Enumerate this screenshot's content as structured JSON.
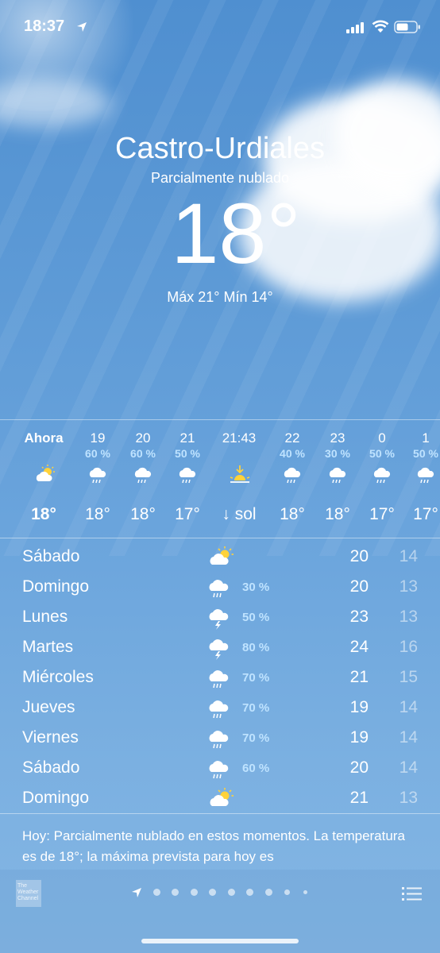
{
  "status": {
    "time": "18:37",
    "icons": [
      "location-arrow-icon",
      "signal-icon",
      "wifi-icon",
      "battery-icon"
    ]
  },
  "weather": {
    "city": "Castro-Urdiales",
    "condition": "Parcialmente nublado",
    "temperature": "18°",
    "hilo": "Máx 21° Mín 14°"
  },
  "hourly": [
    {
      "hour": "Ahora",
      "precip": "",
      "icon": "partly-cloudy-icon",
      "temp": "18°"
    },
    {
      "hour": "19",
      "precip": "60 %",
      "icon": "rain-icon",
      "temp": "18°"
    },
    {
      "hour": "20",
      "precip": "60 %",
      "icon": "rain-icon",
      "temp": "18°"
    },
    {
      "hour": "21",
      "precip": "50 %",
      "icon": "rain-icon",
      "temp": "17°"
    },
    {
      "hour": "21:43",
      "precip": "",
      "icon": "sunset-icon",
      "temp": "↓ sol"
    },
    {
      "hour": "22",
      "precip": "40 %",
      "icon": "rain-icon",
      "temp": "18°"
    },
    {
      "hour": "23",
      "precip": "30 %",
      "icon": "rain-icon",
      "temp": "18°"
    },
    {
      "hour": "0",
      "precip": "50 %",
      "icon": "rain-icon",
      "temp": "17°"
    },
    {
      "hour": "1",
      "precip": "50 %",
      "icon": "rain-icon",
      "temp": "17°"
    }
  ],
  "daily": [
    {
      "day": "Sábado",
      "icon": "partly-cloudy-icon",
      "precip": "",
      "high": "20",
      "low": "14"
    },
    {
      "day": "Domingo",
      "icon": "rain-icon",
      "precip": "30 %",
      "high": "20",
      "low": "13"
    },
    {
      "day": "Lunes",
      "icon": "thunderstorm-icon",
      "precip": "50 %",
      "high": "23",
      "low": "13"
    },
    {
      "day": "Martes",
      "icon": "thunderstorm-icon",
      "precip": "80 %",
      "high": "24",
      "low": "16"
    },
    {
      "day": "Miércoles",
      "icon": "rain-icon",
      "precip": "70 %",
      "high": "21",
      "low": "15"
    },
    {
      "day": "Jueves",
      "icon": "rain-icon",
      "precip": "70 %",
      "high": "19",
      "low": "14"
    },
    {
      "day": "Viernes",
      "icon": "rain-icon",
      "precip": "70 %",
      "high": "19",
      "low": "14"
    },
    {
      "day": "Sábado",
      "icon": "rain-icon",
      "precip": "60 %",
      "high": "20",
      "low": "14"
    },
    {
      "day": "Domingo",
      "icon": "partly-cloudy-icon",
      "precip": "",
      "high": "21",
      "low": "13"
    }
  ],
  "summary": "Hoy: Parcialmente nublado en estos momentos. La temperatura es de 18°; la máxima prevista para hoy es",
  "footer": {
    "provider_logo": "The Weather Channel",
    "page_count": 9,
    "current_page": 0
  },
  "colors": {
    "precip": "#bfe3ff",
    "sun": "#ffd23a",
    "sky_top": "#4f8fd0",
    "sky_bottom": "#84b6e4"
  }
}
